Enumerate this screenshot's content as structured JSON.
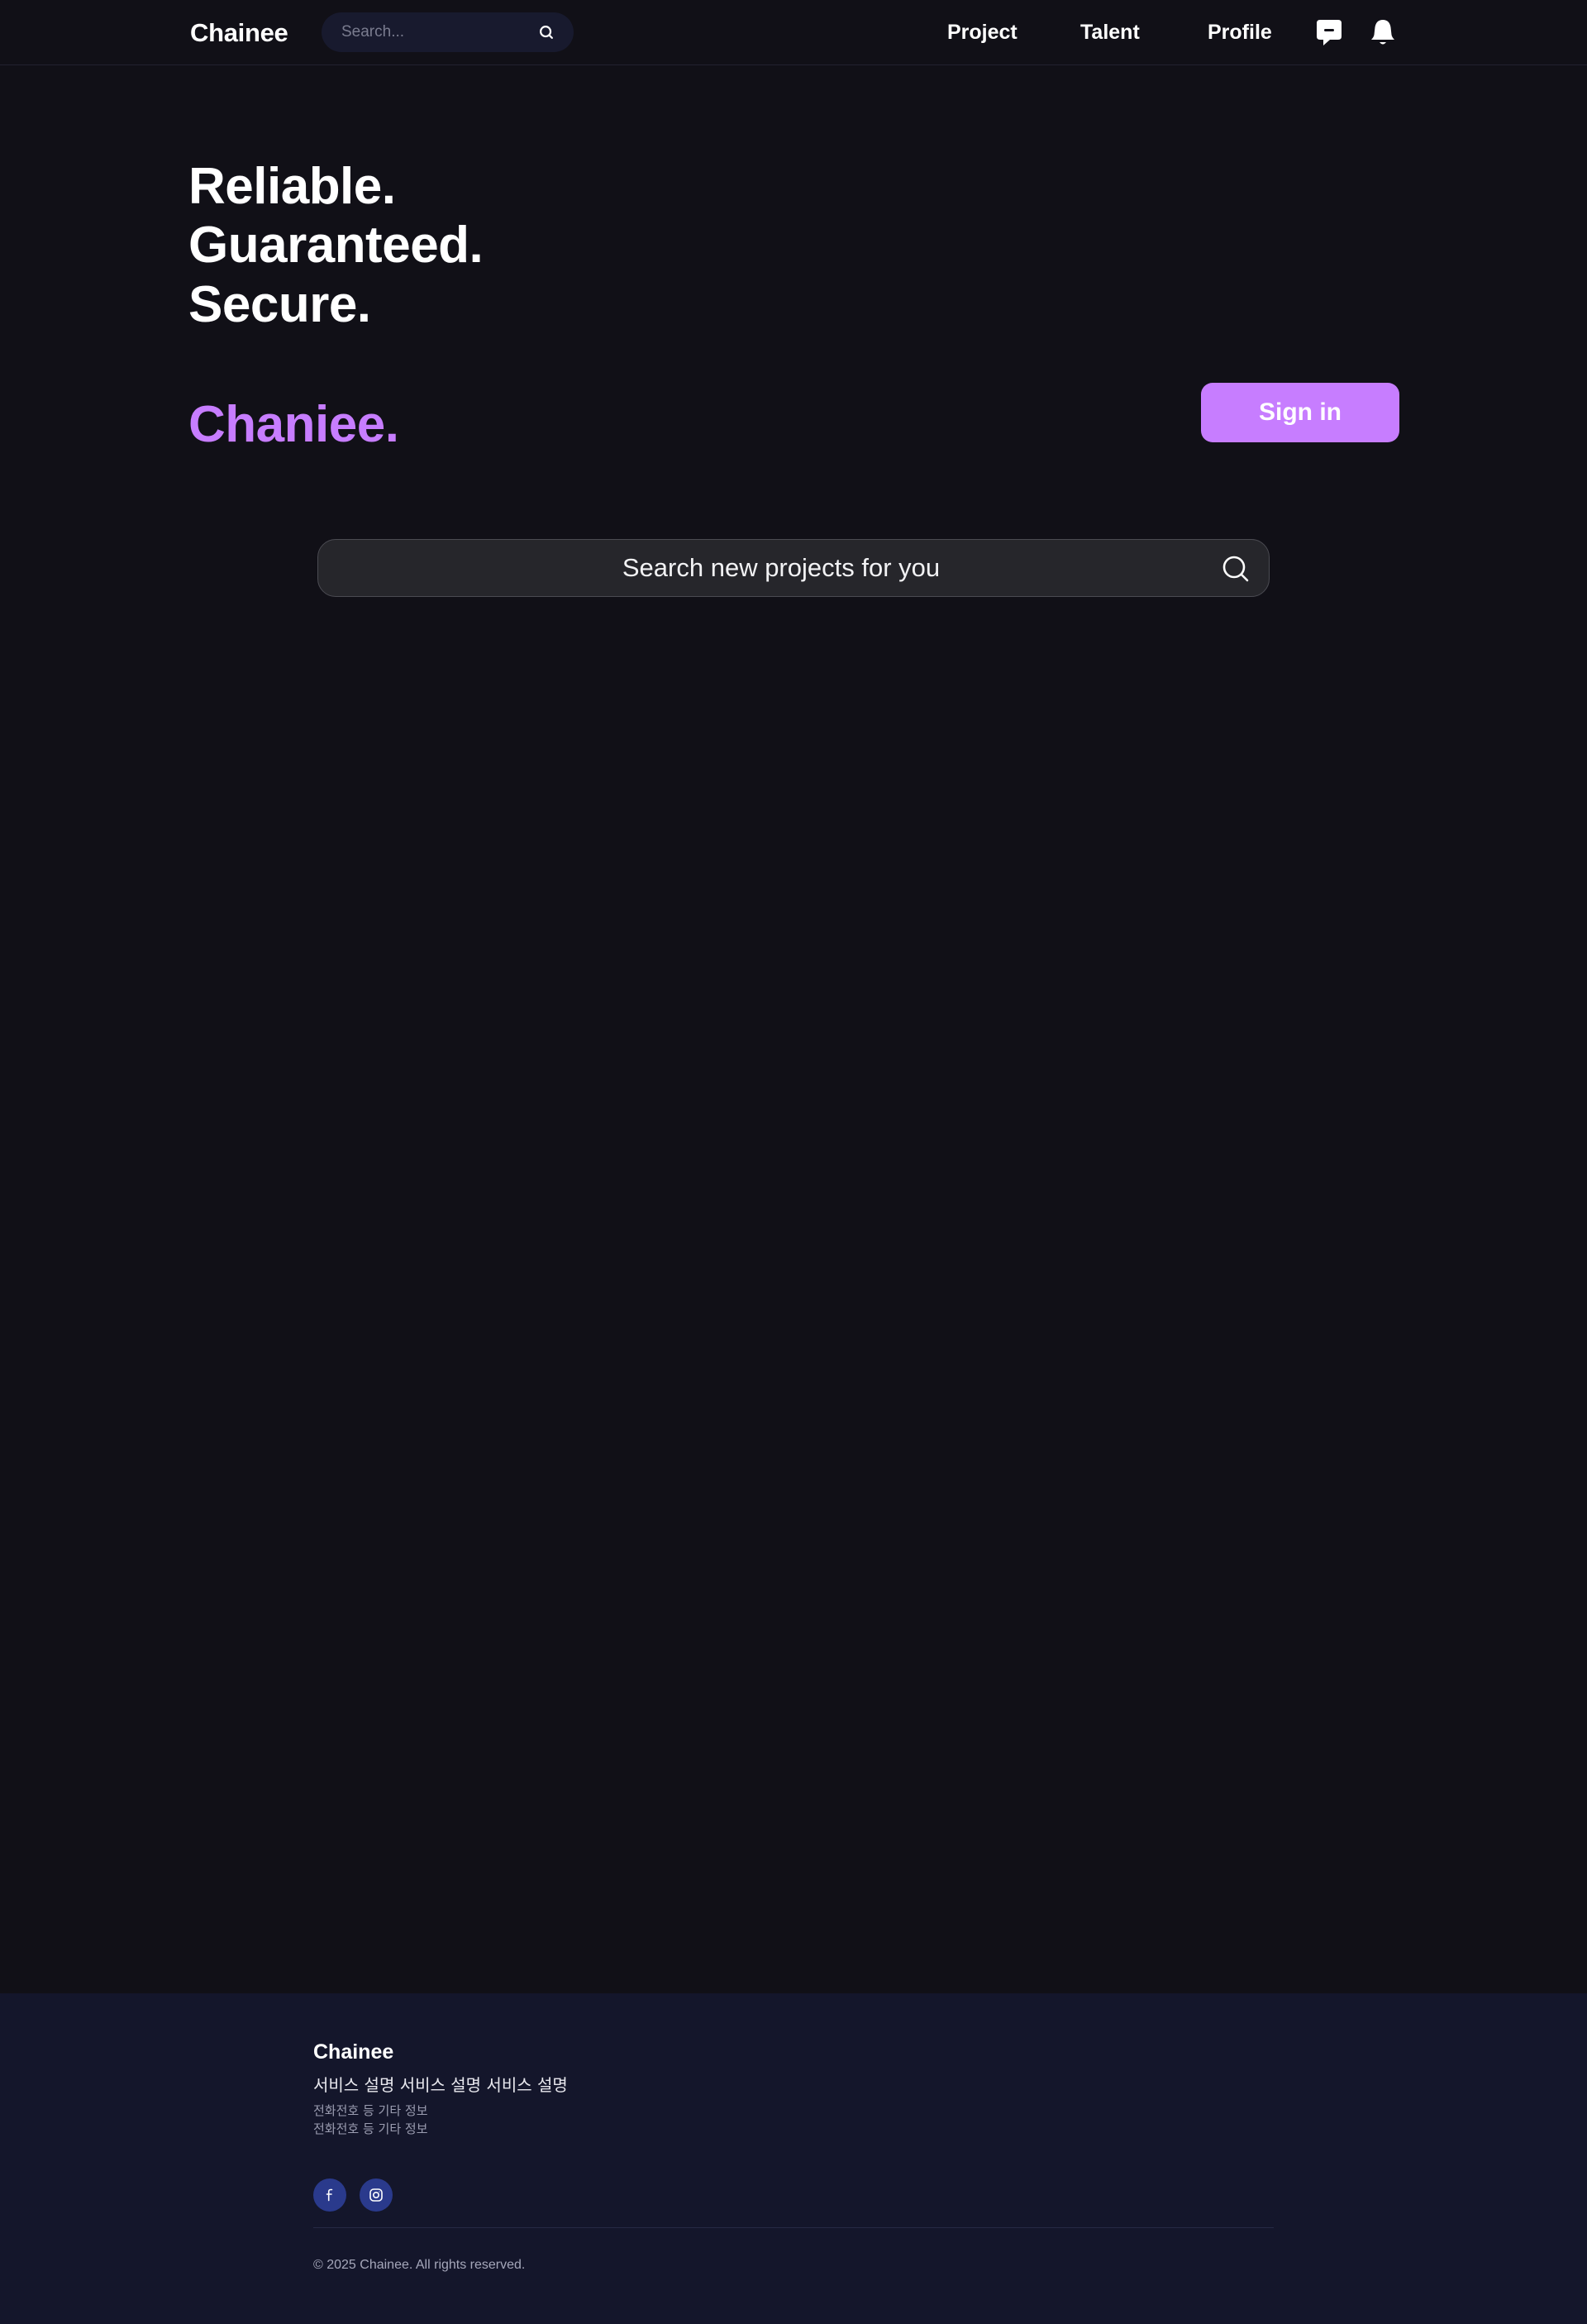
{
  "header": {
    "logo": "Chainee",
    "search_placeholder": "Search...",
    "nav": {
      "project": "Project",
      "talent": "Talent",
      "profile": "Profile"
    },
    "icons": [
      "search-icon",
      "chat-icon",
      "bell-icon"
    ]
  },
  "hero": {
    "lines": [
      "Reliable.",
      "Guaranteed.",
      "Secure."
    ],
    "brand": "Chaniee.",
    "signin_label": "Sign in",
    "search_placeholder": "Search new projects for you"
  },
  "footer": {
    "title": "Chainee",
    "description": "서비스 설명 서비스 설명 서비스 설명",
    "info_lines": [
      "전화전호 등 기타 정보",
      "전화전호 등 기타 정보"
    ],
    "social_icons": [
      "facebook-icon",
      "instagram-icon"
    ],
    "copyright": "© 2025 Chainee. All rights reserved."
  },
  "colors": {
    "background": "#111017",
    "accent": "#c77dff",
    "footer_bg": "#14162b",
    "social_bg": "#2a3a8c"
  }
}
